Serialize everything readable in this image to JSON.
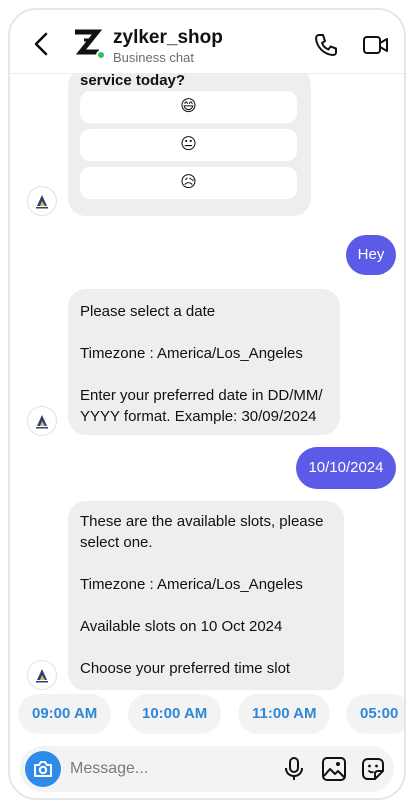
{
  "header": {
    "name": "zylker_shop",
    "subtitle": "Business chat",
    "status_color": "#2fc25b"
  },
  "messages": {
    "rating_question": "service today?",
    "rating_options": [
      "😄",
      "😐",
      "😥"
    ],
    "user_greeting": "Hey",
    "date_prompt": {
      "line1": "Please select a date",
      "line2": "Timezone : America/Los_Angeles",
      "line3": "Enter your preferred date in DD/MM/",
      "line4": "YYYY format. Example: 30/09/2024"
    },
    "user_date": "10/10/2024",
    "slots_prompt": {
      "line1": "These are the available slots, please",
      "line2": "select one.",
      "line3": "Timezone : America/Los_Angeles",
      "line4": "Available slots on 10 Oct 2024",
      "line5": "Choose your preferred time slot"
    }
  },
  "quick_replies": [
    "09:00 AM",
    "10:00 AM",
    "11:00 AM",
    "05:00"
  ],
  "composer": {
    "placeholder": "Message...",
    "camera_color": "#2e8ce8"
  },
  "colors": {
    "user_bubble": "#5b5be8",
    "chip_text": "#2f88d6"
  },
  "icons": [
    "back-icon",
    "brand-logo-icon",
    "phone-icon",
    "video-icon",
    "camera-icon",
    "mic-icon",
    "gallery-icon",
    "sticker-icon"
  ]
}
